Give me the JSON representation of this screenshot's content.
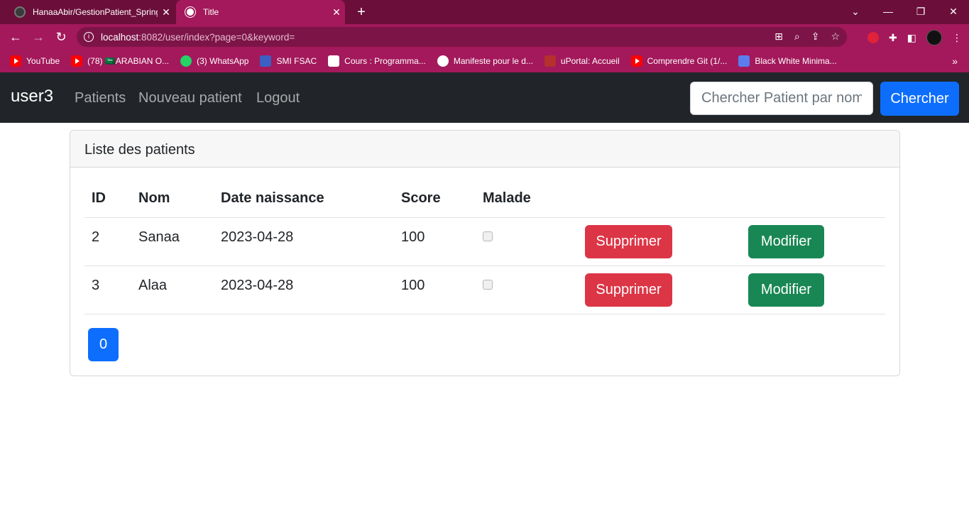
{
  "browser": {
    "tabs": [
      {
        "title": "HanaaAbir/GestionPatient_Spring"
      },
      {
        "title": "Title"
      }
    ],
    "url_host": "localhost",
    "url_rest": ":8082/user/index?page=0&keyword=",
    "bookmarks": [
      {
        "label": "YouTube",
        "icon": "youtube-icon"
      },
      {
        "label": "(78) 🇸🇦ARABIAN O...",
        "icon": "youtube-icon"
      },
      {
        "label": "(3) WhatsApp",
        "icon": "whatsapp-icon"
      },
      {
        "label": "SMI FSAC",
        "icon": "smi-icon"
      },
      {
        "label": "Cours : Programma...",
        "icon": "cours-icon"
      },
      {
        "label": "Manifeste pour le d...",
        "icon": "globe-icon"
      },
      {
        "label": "uPortal: Accueil",
        "icon": "uportal-icon"
      },
      {
        "label": "Comprendre Git (1/...",
        "icon": "youtube-icon"
      },
      {
        "label": "Black White Minima...",
        "icon": "canva-icon"
      }
    ]
  },
  "navbar": {
    "brand": "user3",
    "links": [
      "Patients",
      "Nouveau patient",
      "Logout"
    ],
    "search_placeholder": "Chercher Patient par nom",
    "search_button": "Chercher"
  },
  "card": {
    "header": "Liste des patients",
    "columns": [
      "ID",
      "Nom",
      "Date naissance",
      "Score",
      "Malade"
    ],
    "rows": [
      {
        "id": "2",
        "nom": "Sanaa",
        "date": "2023-04-28",
        "score": "100",
        "malade": false,
        "delete_label": "Supprimer",
        "edit_label": "Modifier"
      },
      {
        "id": "3",
        "nom": "Alaa",
        "date": "2023-04-28",
        "score": "100",
        "malade": false,
        "delete_label": "Supprimer",
        "edit_label": "Modifier"
      }
    ],
    "pages": [
      "0"
    ]
  },
  "colors": {
    "chrome_dark": "#6b0f3a",
    "chrome_accent": "#a3195b",
    "navbar": "#212529",
    "primary": "#0d6efd",
    "danger": "#dc3545",
    "success": "#198754"
  }
}
